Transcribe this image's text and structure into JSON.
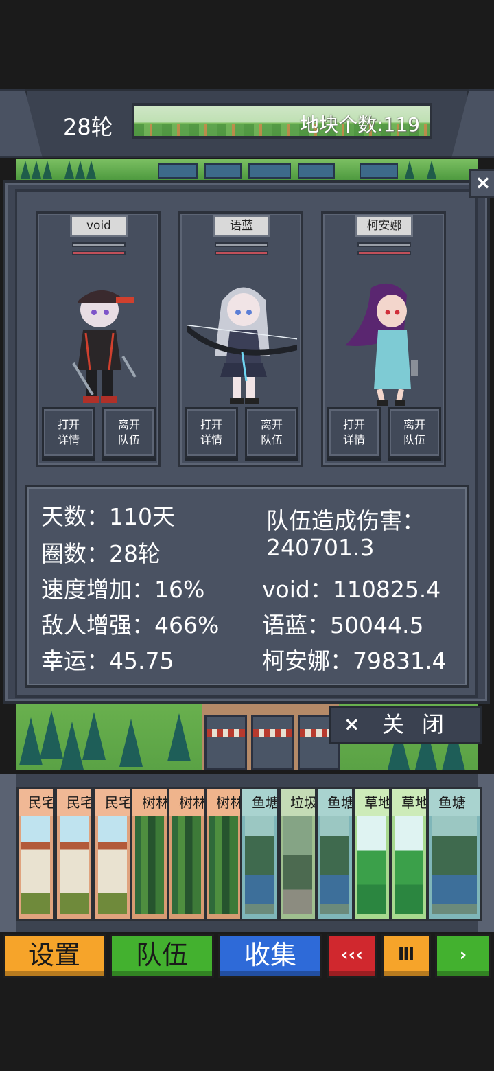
{
  "header": {
    "round": "28轮",
    "tile_count": "地块个数:119"
  },
  "close_x": "×",
  "members": [
    {
      "name": "void",
      "open_label": "打开\n详情",
      "leave_label": "离开\n队伍"
    },
    {
      "name": "语蓝",
      "open_label": "打开\n详情",
      "leave_label": "离开\n队伍"
    },
    {
      "name": "柯安娜",
      "open_label": "打开\n详情",
      "leave_label": "离开\n队伍"
    }
  ],
  "stats": {
    "days": "天数：110天",
    "laps": "圈数：28轮",
    "speed": "速度增加：16%",
    "enemy": "敌人增强：466%",
    "luck": "幸运：45.75",
    "team_damage_label": "队伍造成伤害：",
    "team_damage_value": "240701.3",
    "damage_void": "void：110825.4",
    "damage_yulan": "语蓝：50044.5",
    "damage_keanna": "柯安娜：79831.4"
  },
  "close_button": {
    "x": "×",
    "label": "关闭"
  },
  "cards": [
    {
      "type": "house",
      "title": "民宅"
    },
    {
      "type": "house",
      "title": "民宅"
    },
    {
      "type": "house",
      "title": "民宅"
    },
    {
      "type": "forest",
      "title": "树林"
    },
    {
      "type": "forest",
      "title": "树林"
    },
    {
      "type": "forest",
      "title": "树林"
    },
    {
      "type": "pond",
      "title": "鱼塘"
    },
    {
      "type": "trash",
      "title": "垃圾"
    },
    {
      "type": "pond",
      "title": "鱼塘"
    },
    {
      "type": "grass",
      "title": "草地"
    },
    {
      "type": "grass",
      "title": "草地"
    },
    {
      "type": "pond",
      "title": "鱼塘"
    }
  ],
  "bottom_bar": {
    "settings": "设置",
    "team": "队伍",
    "collect": "收集",
    "rewind": "‹‹‹",
    "pause": "Ⅲ",
    "play": "›"
  }
}
